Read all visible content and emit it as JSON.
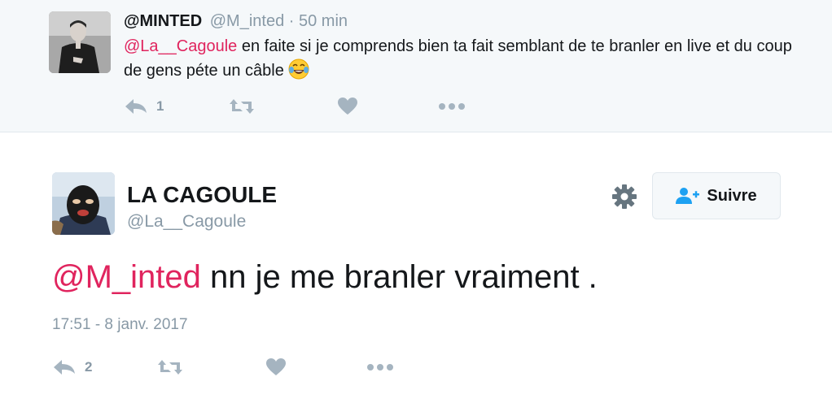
{
  "reply_tweet": {
    "name": "@MINTED",
    "handle": "@M_inted",
    "separator": "·",
    "time": "50 min",
    "mention": "@La__Cagoule",
    "text": " en faite si je comprends bien ta fait semblant de te branler en live et du coup de gens péte un câble ",
    "emoji": "face-with-tears-of-joy-emoji",
    "actions": {
      "reply_count": "1",
      "retweet_count": "",
      "like_count": ""
    }
  },
  "main_tweet": {
    "name": "LA CAGOULE",
    "handle": "@La__Cagoule",
    "follow_label": "Suivre",
    "mention": "@M_inted",
    "text": " nn je me branler vraiment .",
    "timestamp": "17:51 - 8 janv. 2017",
    "actions": {
      "reply_count": "2",
      "retweet_count": "",
      "like_count": ""
    }
  },
  "icons": {
    "reply": "reply-icon",
    "retweet": "retweet-icon",
    "like": "heart-icon",
    "more": "more-icon",
    "settings": "gear-icon",
    "follow": "add-user-icon"
  },
  "colors": {
    "mention": "#e0245e",
    "muted": "#8899a6",
    "text": "#14171a",
    "reply_background": "#f5f8fa",
    "border": "#e1e8ed"
  }
}
